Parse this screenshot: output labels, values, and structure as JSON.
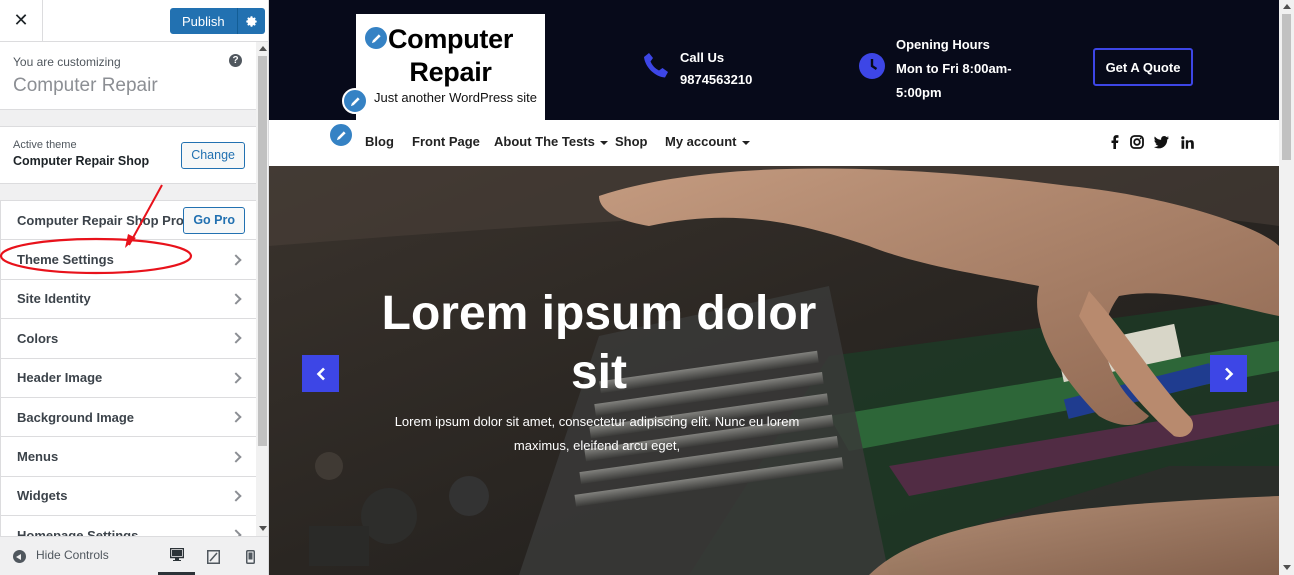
{
  "customizer": {
    "close_glyph": "✕",
    "publish_label": "Publish",
    "customizing_label": "You are customizing",
    "site_name": "Computer Repair",
    "help_glyph": "?",
    "active_theme_label": "Active theme",
    "theme_name": "Computer Repair Shop",
    "change_label": "Change",
    "pro_label": "Computer Repair Shop Pro",
    "gopro_label": "Go Pro",
    "sections": [
      {
        "label": "Theme Settings"
      },
      {
        "label": "Site Identity"
      },
      {
        "label": "Colors"
      },
      {
        "label": "Header Image"
      },
      {
        "label": "Background Image"
      },
      {
        "label": "Menus"
      },
      {
        "label": "Widgets"
      },
      {
        "label": "Homepage Settings"
      }
    ],
    "hide_controls_label": "Hide Controls",
    "devices": [
      "desktop-icon",
      "tablet-icon",
      "mobile-icon"
    ]
  },
  "site": {
    "title": "Computer Repair",
    "tagline": "Just another WordPress site",
    "call_label": "Call Us",
    "call_number": "9874563210",
    "hours_label": "Opening Hours",
    "hours_line1": "Mon to Fri 8:00am-",
    "hours_line2": "5:00pm",
    "quote_label": "Get A Quote",
    "nav": [
      {
        "label": "Blog"
      },
      {
        "label": "Front Page"
      },
      {
        "label": "About The Tests"
      },
      {
        "label": "Shop"
      },
      {
        "label": "My account"
      }
    ],
    "social": [
      "facebook-icon",
      "instagram-icon",
      "twitter-icon",
      "linkedin-icon"
    ],
    "hero_title": "Lorem ipsum dolor sit",
    "hero_text": "Lorem ipsum dolor sit amet, consectetur adipiscing elit. Nunc eu lorem maximus, eleifend arcu eget,"
  },
  "colors": {
    "wp_blue": "#2271b1",
    "topbar_bg": "#070a1a",
    "accent": "#3d46e6",
    "annotation_red": "#e8121b"
  }
}
